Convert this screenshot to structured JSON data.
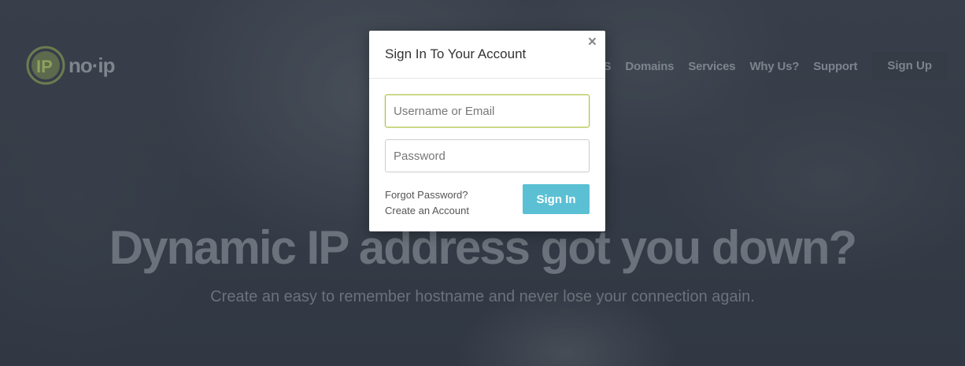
{
  "brand": {
    "logo_text": "no·ip",
    "logo_badge": "IP"
  },
  "nav": {
    "items": [
      "DNS",
      "Domains",
      "Services",
      "Why Us?",
      "Support"
    ],
    "signup_label": "Sign Up"
  },
  "hero": {
    "title": "Dynamic IP address got you down?",
    "subtitle": "Create an easy to remember hostname and never lose your connection again."
  },
  "modal": {
    "title": "Sign In To Your Account",
    "close_label": "×",
    "username_placeholder": "Username or Email",
    "password_placeholder": "Password",
    "forgot_label": "Forgot Password?",
    "create_label": "Create an Account",
    "signin_label": "Sign In"
  },
  "colors": {
    "accent": "#5bc0d4",
    "focus_border": "#a8c23a",
    "logo_green": "#7a9a3a"
  }
}
